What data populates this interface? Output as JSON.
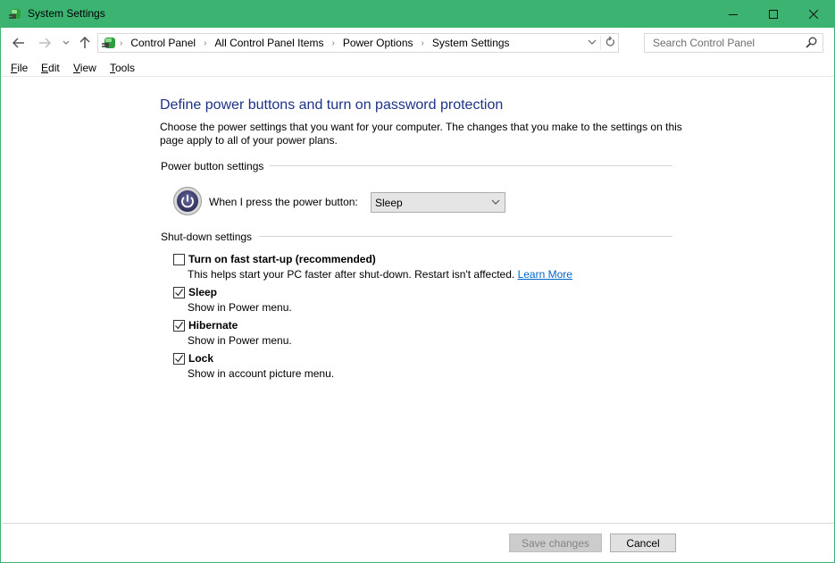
{
  "window": {
    "title": "System Settings",
    "accent_color": "#3cb371",
    "controls": {
      "minimize": "minimize",
      "maximize": "maximize",
      "close": "close"
    }
  },
  "navigation": {
    "back_icon": "arrow-left-icon",
    "forward_icon": "arrow-right-icon",
    "recent_icon": "chevron-down-icon",
    "up_icon": "arrow-up-icon",
    "breadcrumbs": [
      "Control Panel",
      "All Control Panel Items",
      "Power Options",
      "System Settings"
    ],
    "search_placeholder": "Search Control Panel"
  },
  "menu": [
    "File",
    "Edit",
    "View",
    "Tools"
  ],
  "page": {
    "heading": "Define power buttons and turn on password protection",
    "intro": "Choose the power settings that you want for your computer. The changes that you make to the settings on this page apply to all of your power plans.",
    "power_button_group": "Power button settings",
    "power_button_label": "When I press the power button:",
    "power_button_value": "Sleep",
    "shutdown_group": "Shut-down settings",
    "options": [
      {
        "label": "Turn on fast start-up (recommended)",
        "checked": false,
        "description": "This helps start your PC faster after shut-down. Restart isn't affected.",
        "link": "Learn More"
      },
      {
        "label": "Sleep",
        "checked": true,
        "description": "Show in Power menu."
      },
      {
        "label": "Hibernate",
        "checked": true,
        "description": "Show in Power menu."
      },
      {
        "label": "Lock",
        "checked": true,
        "description": "Show in account picture menu."
      }
    ]
  },
  "footer": {
    "save_label": "Save changes",
    "save_enabled": false,
    "cancel_label": "Cancel"
  }
}
